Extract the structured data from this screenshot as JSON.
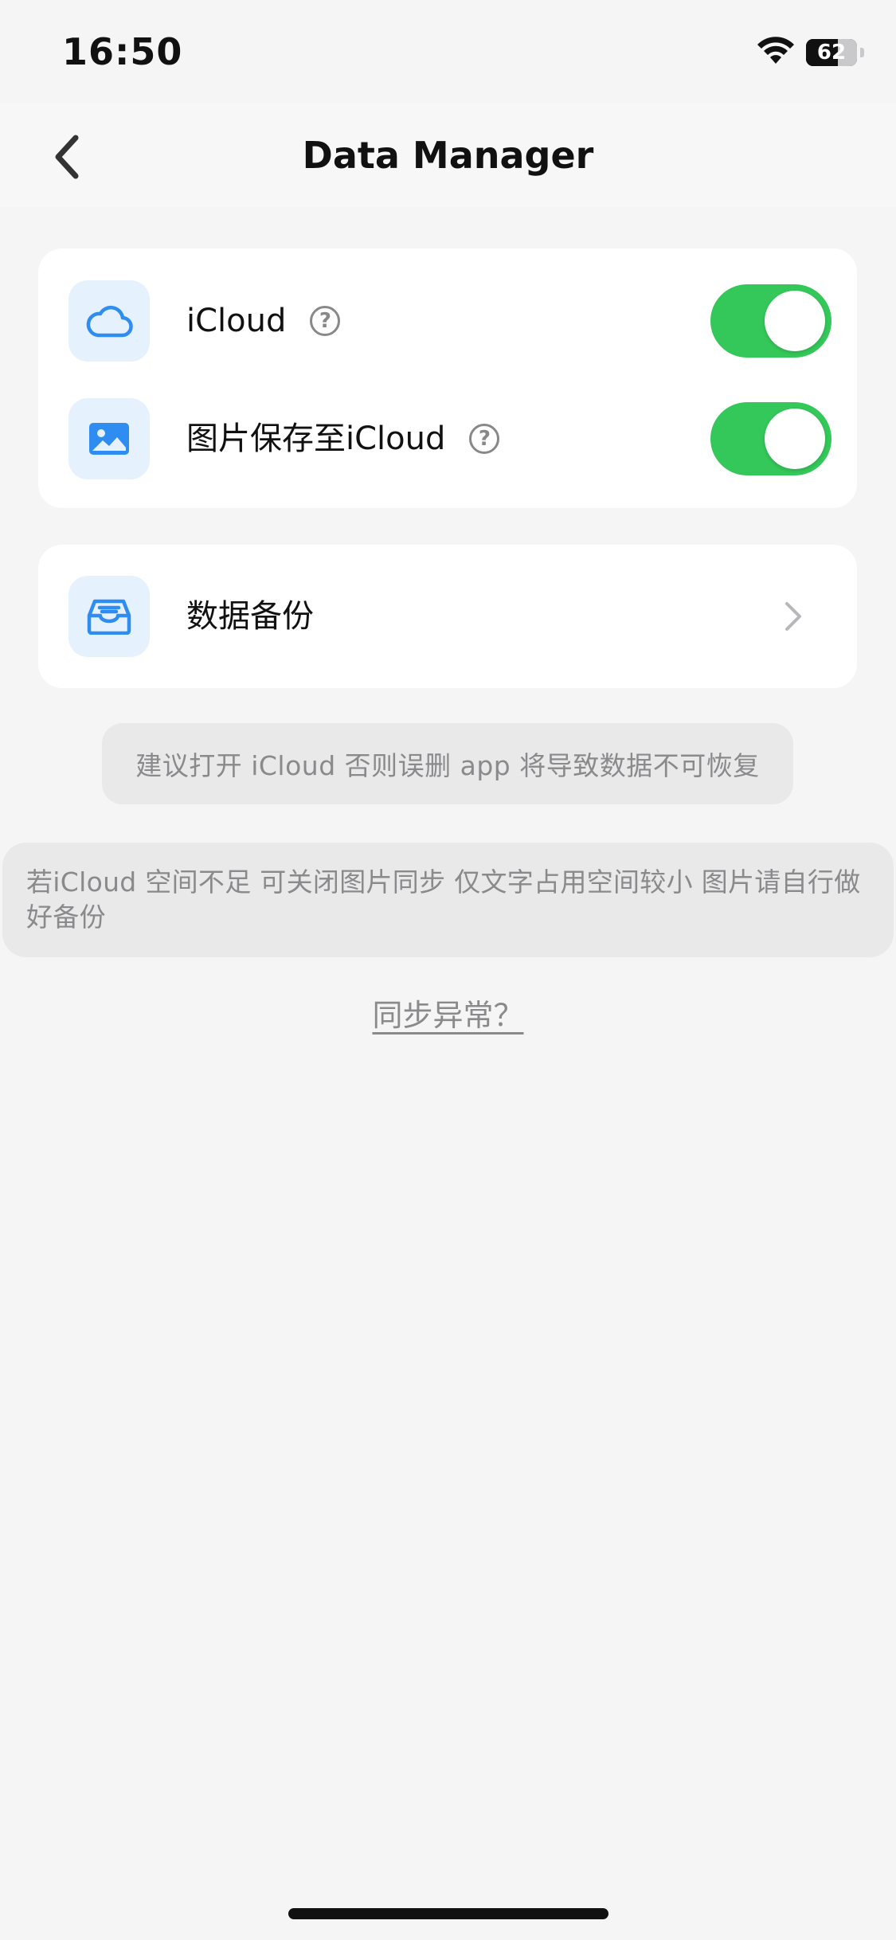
{
  "status_bar": {
    "time": "16:50",
    "battery_level": "62",
    "battery_fraction": 0.62
  },
  "nav": {
    "title": "Data Manager",
    "back_icon": "chevron-left-icon"
  },
  "sync_card": {
    "rows": [
      {
        "label": "iCloud",
        "icon": "cloud-icon",
        "help_symbol": "?",
        "toggle_on": true
      },
      {
        "label": "图片保存至iCloud",
        "icon": "image-icon",
        "help_symbol": "?",
        "toggle_on": true
      }
    ]
  },
  "backup_card": {
    "label": "数据备份",
    "icon": "inbox-tray-icon",
    "chevron": "chevron-right-icon"
  },
  "tips": {
    "primary": "建议打开 iCloud 否则误删 app 将导致数据不可恢复",
    "secondary": "若iCloud 空间不足 可关闭图片同步 仅文字占用空间较小 图片请自行做好备份"
  },
  "sync_issue_link": "同步异常？",
  "colors": {
    "toggle_on": "#34c759",
    "icon_blue": "#2f8cf0",
    "icon_bg": "#e5f1fd",
    "page_bg": "#f5f5f6"
  }
}
